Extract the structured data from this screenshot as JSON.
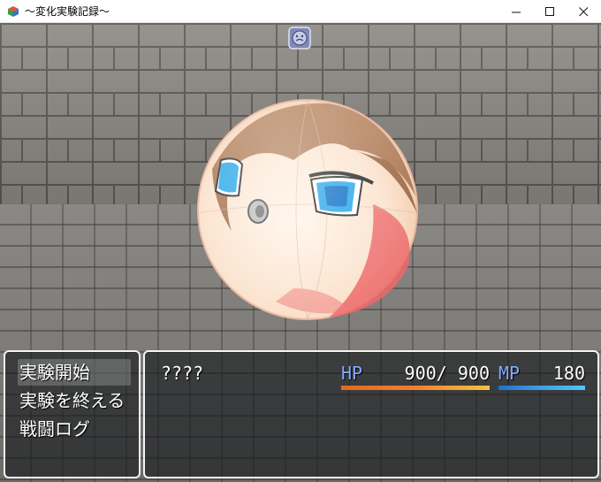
{
  "window": {
    "title": "〜変化実験記録〜",
    "min_glyph": "—",
    "max_glyph": "☐",
    "close_glyph": "✕"
  },
  "colors": {
    "hp_gauge": "#f08030",
    "mp_gauge": "#3fa0e8",
    "gauge_label": "#84aaff",
    "selection": "#c8d2c8"
  },
  "commands": [
    {
      "label": "実験開始",
      "selected": true
    },
    {
      "label": "実験を終える",
      "selected": false
    },
    {
      "label": "戦闘ログ",
      "selected": false
    }
  ],
  "status": {
    "name": "????",
    "hp_label": "HP",
    "hp_value": "900/ 900",
    "hp_ratio": 1.0,
    "mp_label": "MP",
    "mp_value": "180",
    "mp_ratio": 1.0
  },
  "enemy": {
    "icon": "state-face-icon"
  }
}
